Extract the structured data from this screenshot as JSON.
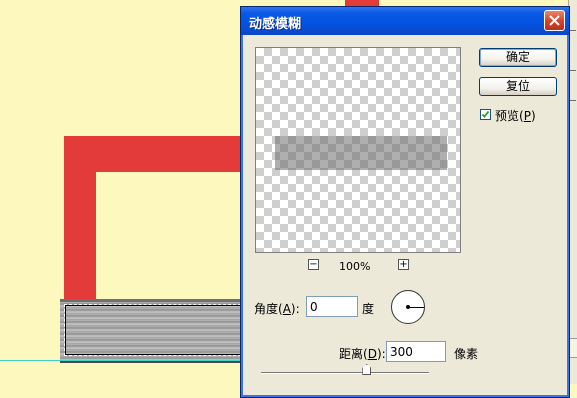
{
  "dialog": {
    "title": "动感模糊",
    "ok_label": "确定",
    "reset_label": "复位",
    "preview_label": "预览",
    "preview_hotkey": "P",
    "preview_checked": true,
    "zoom_out": "−",
    "zoom_in": "+",
    "zoom_level": "100%",
    "angle": {
      "label": "角度",
      "hotkey": "A",
      "value": "0",
      "unit": "度"
    },
    "distance": {
      "label": "距离",
      "hotkey": "D",
      "value": "300",
      "unit": "像素",
      "slider_fraction": 0.63
    }
  },
  "colors": {
    "title_bar": "#0a5be6",
    "canvas_background": "#fdf8bd",
    "shape_red": "#e33a3a"
  },
  "icons": {
    "close": "close-icon",
    "zoom_out": "zoom-out-icon",
    "zoom_in": "zoom-in-icon",
    "check": "checkmark-icon",
    "dial": "angle-dial-icon"
  }
}
